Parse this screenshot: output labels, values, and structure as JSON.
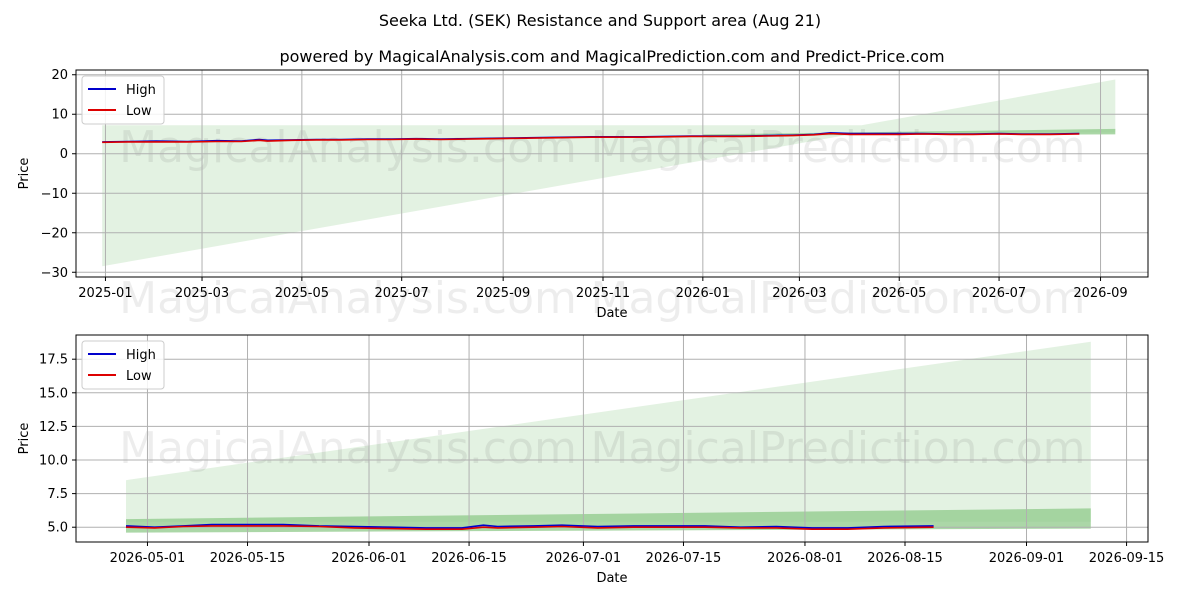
{
  "figure": {
    "title": "Seeka Ltd. (SEK) Resistance and Support area (Aug 21)",
    "subtitle": "powered by MagicalAnalysis.com and MagicalPrediction.com and Predict-Price.com",
    "watermarks": [
      "MagicalAnalysis.com",
      "MagicalPrediction.com"
    ],
    "colors": {
      "high": "#0000cc",
      "low": "#dd0000",
      "band_light": "#c8e6c5",
      "band_dark": "#8fca8a",
      "grid": "#b0b0b0"
    }
  },
  "chart_data": [
    {
      "type": "line",
      "xlabel": "Date",
      "ylabel": "Price",
      "x_domain": [
        "2024-12-14",
        "2026-09-30"
      ],
      "ylim": [
        -31.2,
        21.2
      ],
      "grid": true,
      "legend_position": "upper-left",
      "x_ticks": [
        "2025-01",
        "2025-03",
        "2025-05",
        "2025-07",
        "2025-09",
        "2025-11",
        "2026-01",
        "2026-03",
        "2026-05",
        "2026-07",
        "2026-09"
      ],
      "x_tick_dates": [
        "2025-01-01",
        "2025-03-01",
        "2025-05-01",
        "2025-07-01",
        "2025-09-01",
        "2025-11-01",
        "2026-01-01",
        "2026-03-01",
        "2026-05-01",
        "2026-07-01",
        "2026-09-01"
      ],
      "y_ticks": [
        "−30",
        "−20",
        "−10",
        "0",
        "10",
        "20"
      ],
      "y_tick_values": [
        -30,
        -20,
        -10,
        0,
        10,
        20
      ],
      "band_wide": {
        "dates": [
          "2024-12-30",
          "2026-04-08",
          "2026-09-10"
        ],
        "upper": [
          7.2,
          7.2,
          18.8
        ],
        "lower": [
          -28.5,
          5.4,
          5.4
        ]
      },
      "band_narrow": {
        "dates": [
          "2026-01-01",
          "2026-09-10"
        ],
        "upper": [
          4.9,
          6.3
        ],
        "lower": [
          4.6,
          4.9
        ]
      },
      "series": [
        {
          "name": "High",
          "x": [
            "2024-12-30",
            "2025-01-15",
            "2025-02-01",
            "2025-02-20",
            "2025-03-10",
            "2025-03-25",
            "2025-04-05",
            "2025-04-10",
            "2025-04-25",
            "2025-05-10",
            "2025-05-25",
            "2025-06-10",
            "2025-06-25",
            "2025-07-10",
            "2025-07-25",
            "2025-08-10",
            "2025-08-25",
            "2025-09-10",
            "2025-09-25",
            "2025-10-10",
            "2025-10-25",
            "2025-11-10",
            "2025-11-25",
            "2025-12-10",
            "2025-12-25",
            "2026-01-10",
            "2026-01-25",
            "2026-02-10",
            "2026-02-25",
            "2026-03-10",
            "2026-03-20",
            "2026-04-01",
            "2026-04-15",
            "2026-05-01",
            "2026-05-15",
            "2026-06-01",
            "2026-06-15",
            "2026-07-01",
            "2026-07-15",
            "2026-08-01",
            "2026-08-19"
          ],
          "values": [
            3.0,
            3.1,
            3.2,
            3.1,
            3.3,
            3.2,
            3.6,
            3.4,
            3.5,
            3.6,
            3.6,
            3.7,
            3.7,
            3.8,
            3.7,
            3.8,
            3.9,
            4.0,
            4.1,
            4.2,
            4.3,
            4.3,
            4.3,
            4.4,
            4.5,
            4.5,
            4.5,
            4.6,
            4.7,
            4.9,
            5.3,
            5.1,
            5.1,
            5.1,
            5.1,
            5.0,
            5.0,
            5.1,
            5.0,
            5.0,
            5.1
          ]
        },
        {
          "name": "Low",
          "x": [
            "2024-12-30",
            "2025-01-15",
            "2025-02-01",
            "2025-02-20",
            "2025-03-10",
            "2025-03-25",
            "2025-04-05",
            "2025-04-10",
            "2025-04-25",
            "2025-05-10",
            "2025-05-25",
            "2025-06-10",
            "2025-06-25",
            "2025-07-10",
            "2025-07-25",
            "2025-08-10",
            "2025-08-25",
            "2025-09-10",
            "2025-09-25",
            "2025-10-10",
            "2025-10-25",
            "2025-11-10",
            "2025-11-25",
            "2025-12-10",
            "2025-12-25",
            "2026-01-10",
            "2026-01-25",
            "2026-02-10",
            "2026-02-25",
            "2026-03-10",
            "2026-03-20",
            "2026-04-01",
            "2026-04-15",
            "2026-05-01",
            "2026-05-15",
            "2026-06-01",
            "2026-06-15",
            "2026-07-01",
            "2026-07-15",
            "2026-08-01",
            "2026-08-19"
          ],
          "values": [
            2.9,
            3.0,
            3.0,
            3.0,
            3.1,
            3.1,
            3.4,
            3.2,
            3.4,
            3.5,
            3.5,
            3.6,
            3.6,
            3.7,
            3.6,
            3.7,
            3.8,
            3.9,
            4.0,
            4.1,
            4.2,
            4.2,
            4.2,
            4.3,
            4.4,
            4.4,
            4.4,
            4.5,
            4.6,
            4.8,
            5.1,
            4.9,
            4.9,
            4.9,
            5.0,
            4.9,
            4.9,
            5.0,
            4.9,
            4.9,
            5.0
          ]
        }
      ]
    },
    {
      "type": "line",
      "xlabel": "Date",
      "ylabel": "Price",
      "x_domain": [
        "2026-04-21",
        "2026-09-18"
      ],
      "ylim": [
        3.9,
        19.3
      ],
      "grid": true,
      "legend_position": "upper-left",
      "x_ticks": [
        "2026-05-01",
        "2026-05-15",
        "2026-06-01",
        "2026-06-15",
        "2026-07-01",
        "2026-07-15",
        "2026-08-01",
        "2026-08-15",
        "2026-09-01",
        "2026-09-15"
      ],
      "x_tick_dates": [
        "2026-05-01",
        "2026-05-15",
        "2026-06-01",
        "2026-06-15",
        "2026-07-01",
        "2026-07-15",
        "2026-08-01",
        "2026-08-15",
        "2026-09-01",
        "2026-09-15"
      ],
      "y_ticks": [
        "5.0",
        "7.5",
        "10.0",
        "12.5",
        "15.0",
        "17.5"
      ],
      "y_tick_values": [
        5.0,
        7.5,
        10.0,
        12.5,
        15.0,
        17.5
      ],
      "band_wide": {
        "dates": [
          "2026-04-28",
          "2026-09-10"
        ],
        "upper": [
          8.5,
          18.8
        ],
        "lower": [
          5.4,
          5.4
        ]
      },
      "band_narrow": {
        "dates": [
          "2026-04-28",
          "2026-09-10"
        ],
        "upper": [
          5.6,
          6.4
        ],
        "lower": [
          4.6,
          4.9
        ]
      },
      "series": [
        {
          "name": "High",
          "x": [
            "2026-04-28",
            "2026-05-02",
            "2026-05-06",
            "2026-05-10",
            "2026-05-15",
            "2026-05-20",
            "2026-05-25",
            "2026-05-30",
            "2026-06-04",
            "2026-06-09",
            "2026-06-14",
            "2026-06-17",
            "2026-06-19",
            "2026-06-24",
            "2026-06-28",
            "2026-07-03",
            "2026-07-08",
            "2026-07-13",
            "2026-07-18",
            "2026-07-23",
            "2026-07-28",
            "2026-08-02",
            "2026-08-07",
            "2026-08-12",
            "2026-08-19"
          ],
          "values": [
            5.1,
            5.0,
            5.1,
            5.2,
            5.2,
            5.2,
            5.1,
            5.05,
            5.0,
            4.95,
            4.95,
            5.15,
            5.05,
            5.1,
            5.15,
            5.05,
            5.1,
            5.1,
            5.1,
            5.0,
            5.05,
            4.95,
            4.95,
            5.05,
            5.1
          ]
        },
        {
          "name": "Low",
          "x": [
            "2026-04-28",
            "2026-05-02",
            "2026-05-06",
            "2026-05-10",
            "2026-05-15",
            "2026-05-20",
            "2026-05-25",
            "2026-05-30",
            "2026-06-04",
            "2026-06-09",
            "2026-06-14",
            "2026-06-17",
            "2026-06-19",
            "2026-06-24",
            "2026-06-28",
            "2026-07-03",
            "2026-07-08",
            "2026-07-13",
            "2026-07-18",
            "2026-07-23",
            "2026-07-28",
            "2026-08-02",
            "2026-08-07",
            "2026-08-12",
            "2026-08-19"
          ],
          "values": [
            5.0,
            4.95,
            5.05,
            5.1,
            5.1,
            5.1,
            5.05,
            4.95,
            4.9,
            4.85,
            4.85,
            5.0,
            4.95,
            5.0,
            5.05,
            4.95,
            5.0,
            5.0,
            5.0,
            4.95,
            4.95,
            4.85,
            4.85,
            4.95,
            5.0
          ]
        }
      ]
    }
  ]
}
